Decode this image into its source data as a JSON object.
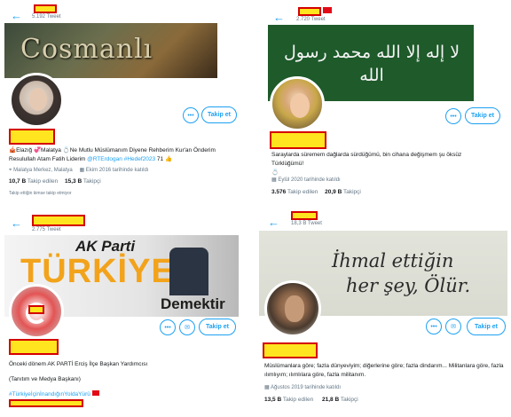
{
  "panels": [
    {
      "tweet_count": "5.192 Tweet",
      "banner_text": "Cosmanlı",
      "follow_label": "Takip et",
      "more_label": "•••",
      "bio": "🎪Elazığ 💞Malatya 💍Ne Mutlu Müslümanım Diyene Rehberim Kur'an Önderim Resulullah Atam Fatih Liderim ",
      "bio_mention": "@RTErdogan",
      "bio_hashtag": "#Hedef2023",
      "bio_suffix": " 71 👍",
      "location": "Malatya Merkez, Malatya",
      "joined": "Ekim 2016 tarihinde katıldı",
      "following_count": "10,7 B",
      "following_label": "Takip edilen",
      "followers_count": "15,3 B",
      "followers_label": "Takipçi",
      "note": "Takip ettiğin kimse takip etmiyor"
    },
    {
      "tweet_count": "2.720 Tweet",
      "banner_text": "لا إله إلا الله محمد رسول الله",
      "follow_label": "Takip et",
      "more_label": "•••",
      "bio": "Saraylarda süremem dağlarda sürdüğümü, bin cihana değişmem şu öksüz Türklüğümü!",
      "bio_emoji": "💍",
      "joined": "Eylül 2020 tarihinde katıldı",
      "following_count": "3.576",
      "following_label": "Takip edilen",
      "followers_count": "20,9 B",
      "followers_label": "Takipçi"
    },
    {
      "tweet_count": "2.775 Tweet",
      "banner_line1": "AK Parti",
      "banner_line2": "TÜRKİYE",
      "banner_line3": "Demektir",
      "follow_label": "Takip et",
      "more_label": "•••",
      "mail_label": "✉",
      "bio_line1": "Önceki dönem AK PARTİ Erciş İlçe Başkan Yardımcısı",
      "bio_line2": "(Tanıtım ve Medya Başkanı)",
      "bio_hashtag": "#TürkiyeİçinİnandığınYoldaYürü"
    },
    {
      "tweet_count": "18,3 B Tweet",
      "banner_line1": "İhmal ettiğin",
      "banner_line2": "her şey, Ölür.",
      "follow_label": "Takip et",
      "more_label": "•••",
      "mail_label": "✉",
      "bio": "Müslümanlara göre; fazla dünyeviyim; diğerlerine göre; fazla dindarım... Militanlara göre, fazla ılımlıyım; ılımlılara göre, fazla militanım.",
      "joined": "Ağustos 2019 tarihinde katıldı",
      "following_count": "13,5 B",
      "following_label": "Takip edilen",
      "followers_count": "21,8 B",
      "followers_label": "Takipçi"
    }
  ],
  "icons": {
    "back": "back-arrow-icon",
    "location": "location-pin-icon",
    "calendar": "calendar-icon"
  },
  "colors": {
    "accent": "#1da1f2",
    "redaction_fill": "#ffe51f",
    "redaction_border": "#d40000"
  }
}
